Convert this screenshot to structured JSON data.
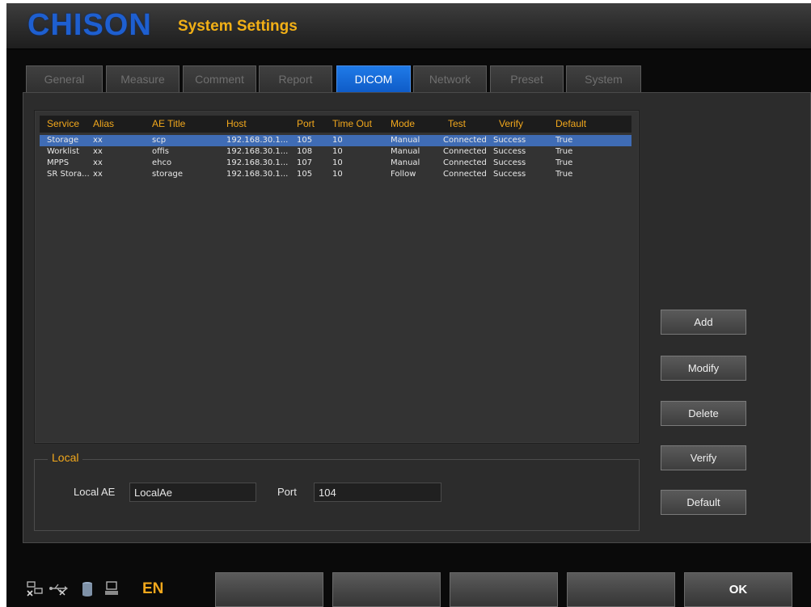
{
  "header": {
    "logo": "CHISON",
    "title": "System Settings"
  },
  "tabs": [
    {
      "label": "General"
    },
    {
      "label": "Measure"
    },
    {
      "label": "Comment"
    },
    {
      "label": "Report"
    },
    {
      "label": "DICOM"
    },
    {
      "label": "Network"
    },
    {
      "label": "Preset"
    },
    {
      "label": "System"
    }
  ],
  "active_tab": "DICOM",
  "table": {
    "headers": [
      "Service",
      "Alias",
      "AE Title",
      "Host",
      "Port",
      "Time Out",
      "Mode",
      "Test",
      "Verify",
      "Default"
    ],
    "rows": [
      [
        "Storage",
        "xx",
        "scp",
        "192.168.30.1...",
        "105",
        "10",
        "Manual",
        "Connected",
        "Success",
        "True"
      ],
      [
        "Worklist",
        "xx",
        "offis",
        "192.168.30.1...",
        "108",
        "10",
        "Manual",
        "Connected",
        "Success",
        "True"
      ],
      [
        "MPPS",
        "xx",
        "ehco",
        "192.168.30.1...",
        "107",
        "10",
        "Manual",
        "Connected",
        "Success",
        "True"
      ],
      [
        "SR Stora...",
        "xx",
        "storage",
        "192.168.30.1...",
        "105",
        "10",
        "Follow",
        "Connected",
        "Success",
        "True"
      ]
    ],
    "selected_row": 0
  },
  "local": {
    "legend": "Local",
    "ae_label": "Local AE",
    "ae_value": "LocalAe",
    "port_label": "Port",
    "port_value": "104"
  },
  "side_buttons": {
    "add": "Add",
    "modify": "Modify",
    "delete": "Delete",
    "verify": "Verify",
    "default": "Default"
  },
  "bottom": {
    "buttons": [
      "",
      "",
      "",
      "",
      ""
    ],
    "ok": "OK",
    "language": "EN",
    "status_icons": [
      "network-disconnected-icon",
      "usb-disconnected-icon",
      "storage-icon",
      "printer-icon"
    ]
  },
  "colors": {
    "accent": "#f2a81c",
    "active_tab": "#1a6fe0",
    "selection": "#3f6cb5",
    "logo": "#1e5fd0"
  }
}
